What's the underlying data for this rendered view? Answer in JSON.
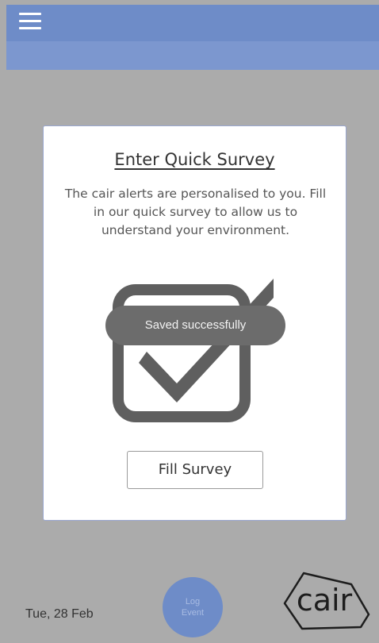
{
  "header": {
    "menu_icon": "hamburger-menu-icon",
    "bar_color": "#6e8cc8",
    "subbar_color": "#7c97cf"
  },
  "survey_card": {
    "title": "Enter Quick Survey",
    "body": "The cair alerts are personalised to you. Fill in our quick survey to allow us to understand your environment.",
    "illustration_icon": "checkbox-checked-icon",
    "button_label": "Fill Survey"
  },
  "toast": {
    "message": "Saved successfully"
  },
  "footer": {
    "date": "Tue, 28 Feb",
    "log_button": {
      "line1": "Log",
      "line2": "Event"
    },
    "logo_text": "cair"
  },
  "colors": {
    "background": "#ababab",
    "accent": "#6e8cc8"
  }
}
